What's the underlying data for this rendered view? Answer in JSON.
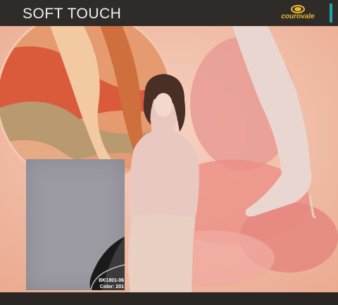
{
  "header": {
    "title": "SOFT TOUCH",
    "logo_text": "courovale"
  },
  "swatch": {
    "code": "BK1801-06",
    "color_label": "Color: 201"
  },
  "colors": {
    "header_bg": "#2f2b28",
    "accent_teal": "#1aa7a2",
    "logo_gold": "#e6b730",
    "swatch_fabric": "#9b9aa3",
    "peach_background": "#f0c4ae"
  }
}
